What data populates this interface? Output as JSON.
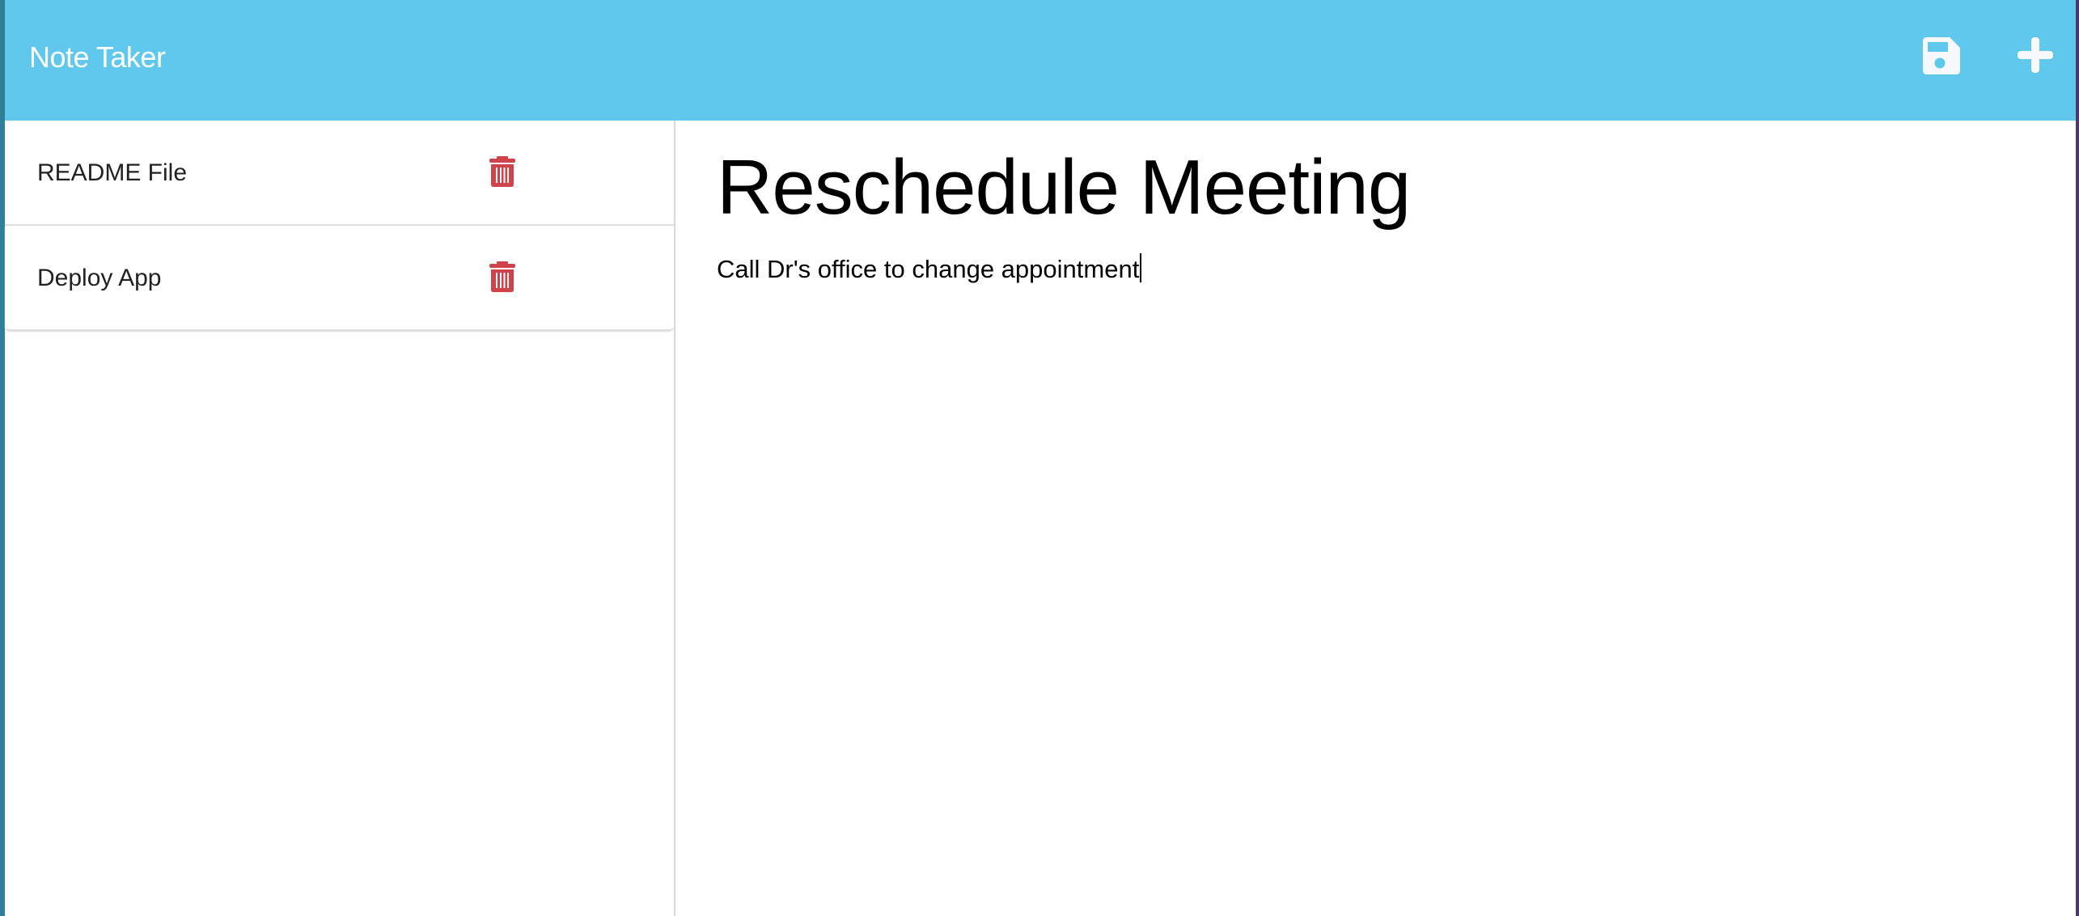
{
  "header": {
    "title": "Note Taker",
    "save_icon": "floppy-disk-icon",
    "new_icon": "plus-icon",
    "background_color": "#5fc8ec"
  },
  "sidebar": {
    "notes": [
      {
        "title": "README File",
        "delete_icon": "trash-icon"
      },
      {
        "title": "Deploy App",
        "delete_icon": "trash-icon"
      }
    ],
    "delete_color": "#d0434a"
  },
  "editor": {
    "title": "Reschedule Meeting",
    "text": "Call Dr's office to change appointment"
  }
}
